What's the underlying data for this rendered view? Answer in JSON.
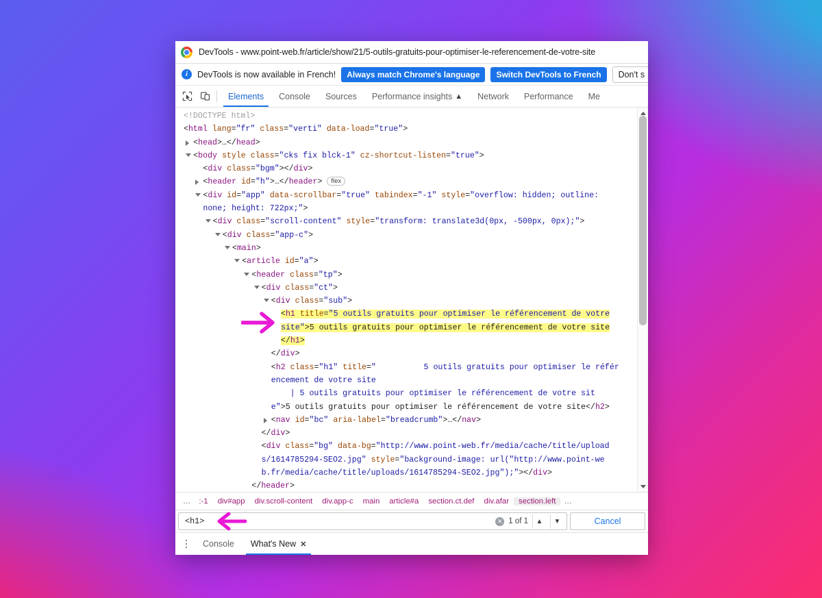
{
  "window": {
    "title": "DevTools - www.point-web.fr/article/show/21/5-outils-gratuits-pour-optimiser-le-referencement-de-votre-site",
    "chrome_logo_icon": "chrome-logo-icon"
  },
  "notification": {
    "info_icon": "info-icon",
    "message": "DevTools is now available in French!",
    "primary_button": "Always match Chrome's language",
    "secondary_button": "Switch DevTools to French",
    "tertiary_button": "Don't s"
  },
  "toolbar": {
    "inspect_icon": "inspect-element-icon",
    "device_toolbar_icon": "device-toolbar-icon",
    "tabs": [
      {
        "label": "Elements",
        "active": true,
        "warn": false
      },
      {
        "label": "Console",
        "active": false,
        "warn": false
      },
      {
        "label": "Sources",
        "active": false,
        "warn": false
      },
      {
        "label": "Performance insights",
        "active": false,
        "warn": true
      },
      {
        "label": "Network",
        "active": false,
        "warn": false
      },
      {
        "label": "Performance",
        "active": false,
        "warn": false
      },
      {
        "label": "Me",
        "active": false,
        "warn": false
      }
    ],
    "warn_glyph": "▲"
  },
  "dom_tree": {
    "lines": [
      {
        "indent": 0,
        "twisty": "",
        "html": "<span class='doctype'>&lt;!DOCTYPE html&gt;</span>"
      },
      {
        "indent": 0,
        "twisty": "",
        "html": "<span class='punc'>&lt;</span><span class='tag'>html</span> <span class='attn'>lang</span><span class='punc'>=</span><span class='attv'>\"fr\"</span> <span class='attn'>class</span><span class='punc'>=</span><span class='attv'>\"verti\"</span> <span class='attn'>data-load</span><span class='punc'>=</span><span class='attv'>\"true\"</span><span class='punc'>&gt;</span>"
      },
      {
        "indent": 1,
        "twisty": "r",
        "html": "<span class='punc'>&lt;</span><span class='tag'>head</span><span class='punc'>&gt;</span><span class='txt'>…</span><span class='punc'>&lt;/</span><span class='tag'>head</span><span class='punc'>&gt;</span>"
      },
      {
        "indent": 1,
        "twisty": "d",
        "html": "<span class='punc'>&lt;</span><span class='tag'>body</span> <span class='attn'>style</span> <span class='attn'>class</span><span class='punc'>=</span><span class='attv'>\"cks fix blck-1\"</span> <span class='attn'>cz-shortcut-listen</span><span class='punc'>=</span><span class='attv'>\"true\"</span><span class='punc'>&gt;</span>"
      },
      {
        "indent": 2,
        "twisty": "",
        "html": "<span class='punc'>&lt;</span><span class='tag'>div</span> <span class='attn'>class</span><span class='punc'>=</span><span class='attv'>\"bgm\"</span><span class='punc'>&gt;&lt;/</span><span class='tag'>div</span><span class='punc'>&gt;</span>"
      },
      {
        "indent": 2,
        "twisty": "r",
        "html": "<span class='punc'>&lt;</span><span class='tag'>header</span> <span class='attn'>id</span><span class='punc'>=</span><span class='attv'>\"h\"</span><span class='punc'>&gt;</span><span class='txt'>…</span><span class='punc'>&lt;/</span><span class='tag'>header</span><span class='punc'>&gt;</span> <span class='badge-flex'>flex</span>"
      },
      {
        "indent": 2,
        "twisty": "d",
        "html": "<span class='punc'>&lt;</span><span class='tag'>div</span> <span class='attn'>id</span><span class='punc'>=</span><span class='attv'>\"app\"</span> <span class='attn'>data-scrollbar</span><span class='punc'>=</span><span class='attv'>\"true\"</span> <span class='attn'>tabindex</span><span class='punc'>=</span><span class='attv'>\"-1\"</span> <span class='attn'>style</span><span class='punc'>=</span><span class='attv'>\"overflow: hidden; outline:</span>"
      },
      {
        "indent": 2,
        "twisty": "",
        "nomark": true,
        "html": "<span class='attv'>none; height: 722px;\"</span><span class='punc'>&gt;</span>"
      },
      {
        "indent": 3,
        "twisty": "d",
        "html": "<span class='punc'>&lt;</span><span class='tag'>div</span> <span class='attn'>class</span><span class='punc'>=</span><span class='attv'>\"scroll-content\"</span> <span class='attn'>style</span><span class='punc'>=</span><span class='attv'>\"transform: translate3d(0px, -500px, 0px);\"</span><span class='punc'>&gt;</span>"
      },
      {
        "indent": 4,
        "twisty": "d",
        "html": "<span class='punc'>&lt;</span><span class='tag'>div</span> <span class='attn'>class</span><span class='punc'>=</span><span class='attv'>\"app-c\"</span><span class='punc'>&gt;</span>"
      },
      {
        "indent": 5,
        "twisty": "d",
        "html": "<span class='punc'>&lt;</span><span class='tag'>main</span><span class='punc'>&gt;</span>"
      },
      {
        "indent": 6,
        "twisty": "d",
        "html": "<span class='punc'>&lt;</span><span class='tag'>article</span> <span class='attn'>id</span><span class='punc'>=</span><span class='attv'>\"a\"</span><span class='punc'>&gt;</span>"
      },
      {
        "indent": 7,
        "twisty": "d",
        "html": "<span class='punc'>&lt;</span><span class='tag'>header</span> <span class='attn'>class</span><span class='punc'>=</span><span class='attv'>\"tp\"</span><span class='punc'>&gt;</span>"
      },
      {
        "indent": 8,
        "twisty": "d",
        "html": "<span class='punc'>&lt;</span><span class='tag'>div</span> <span class='attn'>class</span><span class='punc'>=</span><span class='attv'>\"ct\"</span><span class='punc'>&gt;</span>"
      },
      {
        "indent": 9,
        "twisty": "d",
        "html": "<span class='punc'>&lt;</span><span class='tag'>div</span> <span class='attn'>class</span><span class='punc'>=</span><span class='attv'>\"sub\"</span><span class='punc'>&gt;</span>"
      },
      {
        "indent": 10,
        "twisty": "",
        "hl": true,
        "html": "<span class='punc'>&lt;</span><span class='tag'>h1</span> <span class='attn'>title</span><span class='punc'>=</span><span class='attv'>\"5 outils gratuits pour optimiser le référencement de votre</span>"
      },
      {
        "indent": 10,
        "twisty": "",
        "hl": true,
        "nomark": true,
        "html": "<span class='attv'>site\"</span><span class='punc'>&gt;</span><span class='txt'>5 outils gratuits pour optimiser le référencement de votre site</span>"
      },
      {
        "indent": 10,
        "twisty": "",
        "hl": true,
        "nomark": true,
        "html": "<span class='punc'>&lt;/</span><span class='tag'>h1</span><span class='punc'>&gt;</span>"
      },
      {
        "indent": 9,
        "twisty": "",
        "html": "<span class='punc'>&lt;/</span><span class='tag'>div</span><span class='punc'>&gt;</span>"
      },
      {
        "indent": 9,
        "twisty": "",
        "html": "<span class='punc'>&lt;</span><span class='tag'>h2</span> <span class='attn'>class</span><span class='punc'>=</span><span class='attv'>\"h1\"</span> <span class='attn'>title</span><span class='punc'>=</span><span class='attv'>\"          5 outils gratuits pour optimiser le référ</span>"
      },
      {
        "indent": 9,
        "twisty": "",
        "nomark": true,
        "html": "<span class='attv'>encement de votre site</span>"
      },
      {
        "indent": 9,
        "twisty": "",
        "nomark": true,
        "html": "<span class='attv'>    | 5 outils gratuits pour optimiser le référencement de votre sit</span>"
      },
      {
        "indent": 9,
        "twisty": "",
        "nomark": true,
        "html": "<span class='attv'>e\"</span><span class='punc'>&gt;</span><span class='txt'>5 outils gratuits pour optimiser le référencement de votre site</span><span class='punc'>&lt;/</span><span class='tag'>h2</span><span class='punc'>&gt;</span>"
      },
      {
        "indent": 9,
        "twisty": "r",
        "html": "<span class='punc'>&lt;</span><span class='tag'>nav</span> <span class='attn'>id</span><span class='punc'>=</span><span class='attv'>\"bc\"</span> <span class='attn'>aria-label</span><span class='punc'>=</span><span class='attv'>\"breadcrumb\"</span><span class='punc'>&gt;</span><span class='txt'>…</span><span class='punc'>&lt;/</span><span class='tag'>nav</span><span class='punc'>&gt;</span>"
      },
      {
        "indent": 8,
        "twisty": "",
        "html": "<span class='punc'>&lt;/</span><span class='tag'>div</span><span class='punc'>&gt;</span>"
      },
      {
        "indent": 8,
        "twisty": "",
        "html": "<span class='punc'>&lt;</span><span class='tag'>div</span> <span class='attn'>class</span><span class='punc'>=</span><span class='attv'>\"bg\"</span> <span class='attn'>data-bg</span><span class='punc'>=</span><span class='attv'>\"http://www.point-web.fr/media/cache/title/upload</span>"
      },
      {
        "indent": 8,
        "twisty": "",
        "nomark": true,
        "html": "<span class='attv'>s/1614785294-SEO2.jpg\"</span> <span class='attn'>style</span><span class='punc'>=</span><span class='attv'>\"background-image: url(\"http://www.point-we</span>"
      },
      {
        "indent": 8,
        "twisty": "",
        "nomark": true,
        "html": "<span class='attv'>b.fr/media/cache/title/uploads/1614785294-SEO2.jpg\");\"</span><span class='punc'>&gt;&lt;/</span><span class='tag'>div</span><span class='punc'>&gt;</span>"
      },
      {
        "indent": 7,
        "twisty": "",
        "html": "<span class='punc'>&lt;/</span><span class='tag'>header</span><span class='punc'>&gt;</span>"
      }
    ]
  },
  "breadcrumb": {
    "items": [
      {
        "label": "…",
        "type": "ellipsis"
      },
      {
        "label": ":-1",
        "type": "node"
      },
      {
        "label": "div#app",
        "type": "node"
      },
      {
        "label": "div.scroll-content",
        "type": "node"
      },
      {
        "label": "div.app-c",
        "type": "node"
      },
      {
        "label": "main",
        "type": "node"
      },
      {
        "label": "article#a",
        "type": "node"
      },
      {
        "label": "section.ct.def",
        "type": "node"
      },
      {
        "label": "div.afar",
        "type": "node"
      },
      {
        "label": "section.left",
        "type": "node",
        "selected": true
      },
      {
        "label": "…",
        "type": "ellipsis"
      }
    ]
  },
  "search": {
    "value": "<h1>",
    "placeholder": "",
    "clear_icon": "clear-search-icon",
    "match_count": "1 of 1",
    "prev_icon": "chevron-up-icon",
    "next_icon": "chevron-down-icon",
    "cancel_label": "Cancel"
  },
  "drawer": {
    "menu_icon": "more-options-icon",
    "tabs": [
      {
        "label": "Console",
        "active": false,
        "closable": false
      },
      {
        "label": "What's New",
        "active": true,
        "closable": true
      }
    ],
    "close_icon": "close-icon"
  },
  "annotations": {
    "h1_arrow": "arrow-right-annotation",
    "search_arrow": "arrow-left-annotation",
    "color": "#e919d6"
  },
  "scrollbar": {
    "up_icon": "scroll-up-arrow-icon",
    "down_icon": "scroll-down-arrow-icon",
    "thumb": "scrollbar-thumb"
  },
  "colors": {
    "accent_blue": "#1a73e8",
    "highlight_yellow": "#fffb88",
    "tag_purple": "#881280",
    "attr_orange": "#994500",
    "value_blue": "#1a1aa6",
    "crumb_pink": "#a01c77"
  }
}
